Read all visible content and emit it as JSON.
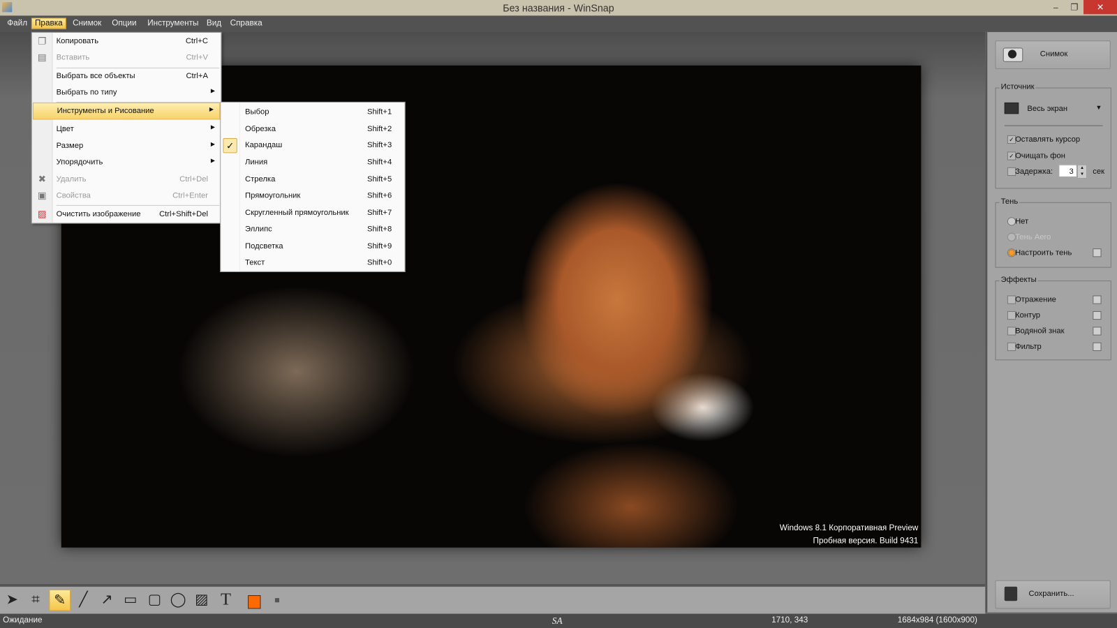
{
  "window": {
    "title": "Без названия - WinSnap",
    "minimize": "–",
    "restore": "❐",
    "close": "✕"
  },
  "menubar": [
    "Файл",
    "Правка",
    "Снимок",
    "Опции",
    "Инструменты",
    "Вид",
    "Справка"
  ],
  "edit_menu": [
    {
      "label": "Копировать",
      "shortcut": "Ctrl+C",
      "icon": "copy-icon"
    },
    {
      "label": "Вставить",
      "shortcut": "Ctrl+V",
      "icon": "paste-icon",
      "disabled": true
    },
    {
      "label": "Выбрать все объекты",
      "shortcut": "Ctrl+A"
    },
    {
      "label": "Выбрать по типу",
      "submenu": true
    },
    {
      "label": "Инструменты и Рисование",
      "submenu": true,
      "highlighted": true
    },
    {
      "label": "Цвет",
      "submenu": true
    },
    {
      "label": "Размер",
      "submenu": true
    },
    {
      "label": "Упорядочить",
      "submenu": true
    },
    {
      "label": "Удалить",
      "shortcut": "Ctrl+Del",
      "icon": "delete-icon",
      "disabled": true
    },
    {
      "label": "Свойства",
      "shortcut": "Ctrl+Enter",
      "icon": "properties-icon",
      "disabled": true
    },
    {
      "label": "Очистить изображение",
      "shortcut": "Ctrl+Shift+Del",
      "icon": "clear-image-icon"
    }
  ],
  "tools_submenu": [
    {
      "label": "Выбор",
      "shortcut": "Shift+1"
    },
    {
      "label": "Обрезка",
      "shortcut": "Shift+2"
    },
    {
      "label": "Карандаш",
      "shortcut": "Shift+3",
      "checked": true
    },
    {
      "label": "Линия",
      "shortcut": "Shift+4"
    },
    {
      "label": "Стрелка",
      "shortcut": "Shift+5"
    },
    {
      "label": "Прямоугольник",
      "shortcut": "Shift+6"
    },
    {
      "label": "Скругленный прямоугольник",
      "shortcut": "Shift+7"
    },
    {
      "label": "Эллипс",
      "shortcut": "Shift+8"
    },
    {
      "label": "Подсветка",
      "shortcut": "Shift+9"
    },
    {
      "label": "Текст",
      "shortcut": "Shift+0"
    }
  ],
  "watermark": [
    "Windows 8.1 Корпоративная Preview",
    "Пробная версия. Build 9431"
  ],
  "panel": {
    "snap_button": "Снимок",
    "source": {
      "title": "Источник",
      "value": "Весь экран",
      "keep_cursor": "Оставлять курсор",
      "keep_cursor_checked": true,
      "clear_bg": "Очищать фон",
      "clear_bg_checked": true,
      "delay": "Задержка:",
      "delay_checked": false,
      "delay_value": "3",
      "delay_unit": "сек"
    },
    "shadow": {
      "title": "Тень",
      "options": [
        "Нет",
        "Тень Aero",
        "Настроить тень"
      ],
      "selected": "Настроить тень"
    },
    "effects": {
      "title": "Эффекты",
      "items": [
        "Отражение",
        "Контур",
        "Водяной знак",
        "Фильтр"
      ]
    },
    "save_button": "Сохранить..."
  },
  "toolbar": {
    "active": "pencil",
    "color": "#ff6a00"
  },
  "status": {
    "state": "Ожидание",
    "logo": "SA",
    "coords": "1710, 343",
    "size": "1684x984 (1600x900)"
  }
}
